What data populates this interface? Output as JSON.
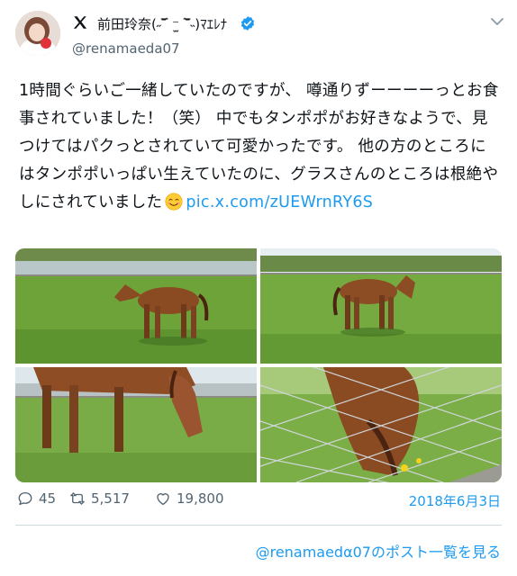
{
  "author": {
    "display_name": "前田玲奈(˶‾᷄ ⁻̫ ‾᷅˵)ﾏｴﾚﾅ",
    "handle": "@renamaeda07",
    "verified": true,
    "platform_icon": "x-logo-icon"
  },
  "tweet": {
    "text": "1時間ぐらいご一緒していたのですが、 噂通りずーーーーっとお食事されていました！（笑） 中でもタンポポがお好きなようで、見つけてはパクっとされていて可愛かったです。 他の方のところにはタンポポいっぱい生えていたのに、グラスさんのところは根絶やしにされていました",
    "emoji": "smiling-face-icon",
    "link": "pic.x.com/zUEWrnRY6S"
  },
  "actions": {
    "replies": "45",
    "retweets": "5,517",
    "likes": "19,800",
    "date": "2018年6月3日"
  },
  "footer": {
    "more_link": "@renamaedα07のポスト一覧を見る"
  },
  "colors": {
    "link": "#1d9bf0",
    "text": "#0f1419",
    "muted": "#536471",
    "verified": "#1d9bf0"
  }
}
